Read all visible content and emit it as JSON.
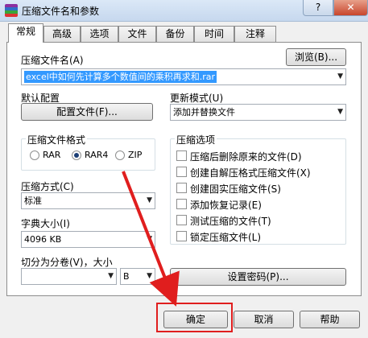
{
  "window": {
    "title": "压缩文件名和参数",
    "help_label": "?",
    "close_label": "✕"
  },
  "tabs": [
    "常规",
    "高级",
    "选项",
    "文件",
    "备份",
    "时间",
    "注释"
  ],
  "archive_name": {
    "label": "压缩文件名(A)",
    "value": "excel中如何先计算多个数值间的乘积再求和.rar",
    "browse_label": "浏览(B)..."
  },
  "profile": {
    "label": "默认配置",
    "button_label": "配置文件(F)..."
  },
  "update_mode": {
    "label": "更新模式(U)",
    "value": "添加并替换文件"
  },
  "format": {
    "group_title": "压缩文件格式",
    "options": [
      "RAR",
      "RAR4",
      "ZIP"
    ],
    "selected": "RAR4"
  },
  "method": {
    "label": "压缩方式(C)",
    "value": "标准"
  },
  "dictionary": {
    "label": "字典大小(I)",
    "value": "4096 KB"
  },
  "split": {
    "label": "切分为分卷(V)，大小",
    "value": "",
    "unit": "B"
  },
  "options": {
    "group_title": "压缩选项",
    "items": [
      "压缩后删除原来的文件(D)",
      "创建自解压格式压缩文件(X)",
      "创建固实压缩文件(S)",
      "添加恢复记录(E)",
      "测试压缩的文件(T)",
      "锁定压缩文件(L)"
    ]
  },
  "password_button": "设置密码(P)...",
  "footer": {
    "ok": "确定",
    "cancel": "取消",
    "help": "帮助"
  },
  "annotation": {
    "color": "#e01e1e"
  }
}
